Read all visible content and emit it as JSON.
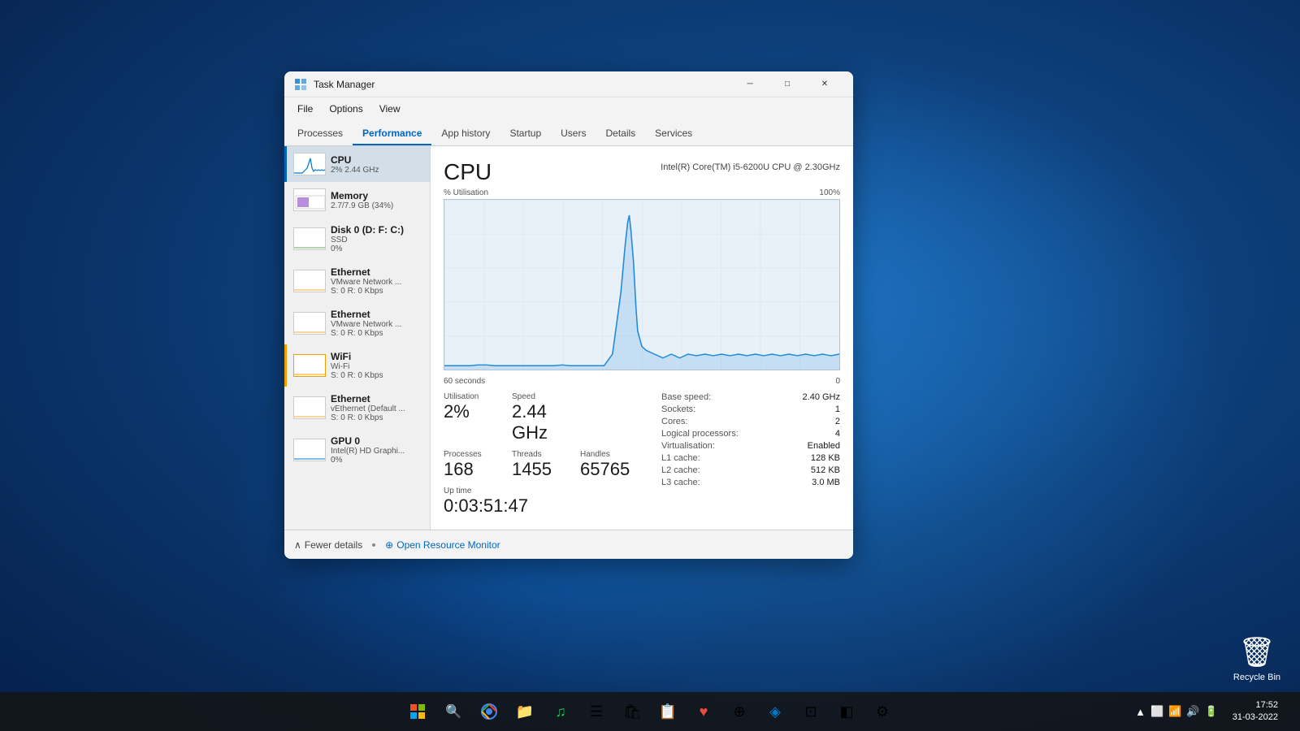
{
  "desktop": {
    "recycle_bin": {
      "label": "Recycle Bin"
    }
  },
  "taskbar": {
    "time": "17:52",
    "date": "31-03-2022",
    "icons": [
      {
        "name": "start",
        "symbol": "⊞"
      },
      {
        "name": "search",
        "symbol": "🔍"
      },
      {
        "name": "chrome",
        "symbol": "●"
      },
      {
        "name": "explorer",
        "symbol": "📁"
      },
      {
        "name": "spotify",
        "symbol": "♫"
      },
      {
        "name": "teams",
        "symbol": "☰"
      },
      {
        "name": "store",
        "symbol": "🛍"
      },
      {
        "name": "stickynotes",
        "symbol": "📋"
      },
      {
        "name": "app1",
        "symbol": "❤"
      },
      {
        "name": "app2",
        "symbol": "◈"
      },
      {
        "name": "vscode",
        "symbol": "⬡"
      },
      {
        "name": "app3",
        "symbol": "⊡"
      },
      {
        "name": "app4",
        "symbol": "◧"
      },
      {
        "name": "settings",
        "symbol": "⚙"
      }
    ],
    "tray": [
      "▲",
      "⬜",
      "⚡",
      "📶",
      "🔊",
      "🔋"
    ]
  },
  "window": {
    "title": "Task Manager",
    "menu": [
      "File",
      "Options",
      "View"
    ],
    "tabs": [
      "Processes",
      "Performance",
      "App history",
      "Startup",
      "Users",
      "Details",
      "Services"
    ],
    "active_tab": "Performance"
  },
  "sidebar": {
    "items": [
      {
        "name": "CPU",
        "detail1": "2% 2.44 GHz",
        "detail2": "",
        "active": true,
        "type": "cpu"
      },
      {
        "name": "Memory",
        "detail1": "2.7/7.9 GB (34%)",
        "detail2": "",
        "active": false,
        "type": "memory"
      },
      {
        "name": "Disk 0 (D: F: C:)",
        "detail1": "SSD",
        "detail2": "0%",
        "active": false,
        "type": "disk"
      },
      {
        "name": "Ethernet",
        "detail1": "VMware Network ...",
        "detail2": "S: 0 R: 0 Kbps",
        "active": false,
        "type": "ethernet"
      },
      {
        "name": "Ethernet",
        "detail1": "VMware Network ...",
        "detail2": "S: 0 R: 0 Kbps",
        "active": false,
        "type": "ethernet"
      },
      {
        "name": "WiFi",
        "detail1": "Wi-Fi",
        "detail2": "S: 0 R: 0 Kbps",
        "active": false,
        "type": "wifi"
      },
      {
        "name": "Ethernet",
        "detail1": "vEthernet (Default ...",
        "detail2": "S: 0 R: 0 Kbps",
        "active": false,
        "type": "ethernet"
      },
      {
        "name": "GPU 0",
        "detail1": "Intel(R) HD Graphi...",
        "detail2": "0%",
        "active": false,
        "type": "gpu"
      }
    ]
  },
  "detail": {
    "title": "CPU",
    "cpu_name": "Intel(R) Core(TM) i5-6200U CPU @ 2.30GHz",
    "util_label": "% Utilisation",
    "util_max": "100%",
    "time_left": "60 seconds",
    "time_right": "0",
    "stats": {
      "utilisation_label": "Utilisation",
      "utilisation_value": "2%",
      "speed_label": "Speed",
      "speed_value": "2.44 GHz",
      "processes_label": "Processes",
      "processes_value": "168",
      "threads_label": "Threads",
      "threads_value": "1455",
      "handles_label": "Handles",
      "handles_value": "65765",
      "uptime_label": "Up time",
      "uptime_value": "0:03:51:47"
    },
    "info": {
      "base_speed_label": "Base speed:",
      "base_speed_value": "2.40 GHz",
      "sockets_label": "Sockets:",
      "sockets_value": "1",
      "cores_label": "Cores:",
      "cores_value": "2",
      "logical_label": "Logical processors:",
      "logical_value": "4",
      "virt_label": "Virtualisation:",
      "virt_value": "Enabled",
      "l1_label": "L1 cache:",
      "l1_value": "128 KB",
      "l2_label": "L2 cache:",
      "l2_value": "512 KB",
      "l3_label": "L3 cache:",
      "l3_value": "3.0 MB"
    }
  },
  "footer": {
    "fewer_details": "Fewer details",
    "open_resource": "Open Resource Monitor"
  }
}
